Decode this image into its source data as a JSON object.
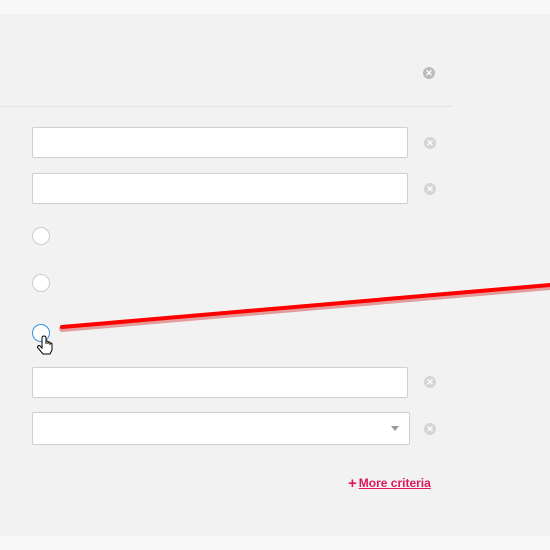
{
  "header": {
    "close_icon": "close-circle-icon"
  },
  "criteria_rows": [
    {
      "type": "text",
      "value": "",
      "remove_icon": "remove-circle-icon"
    },
    {
      "type": "text",
      "value": "",
      "remove_icon": "remove-circle-icon"
    },
    {
      "type": "radio",
      "checked": false
    },
    {
      "type": "radio",
      "checked": false
    },
    {
      "type": "radio",
      "checked": false,
      "hovered": true
    },
    {
      "type": "text",
      "value": "",
      "remove_icon": "remove-circle-icon"
    },
    {
      "type": "select",
      "value": "",
      "remove_icon": "remove-circle-icon"
    }
  ],
  "more_criteria": {
    "plus": "+",
    "label": "More criteria"
  },
  "annotation": {
    "color": "#ff0000"
  },
  "colors": {
    "accent": "#e0195a",
    "radio_hover": "#3b8fd9"
  }
}
